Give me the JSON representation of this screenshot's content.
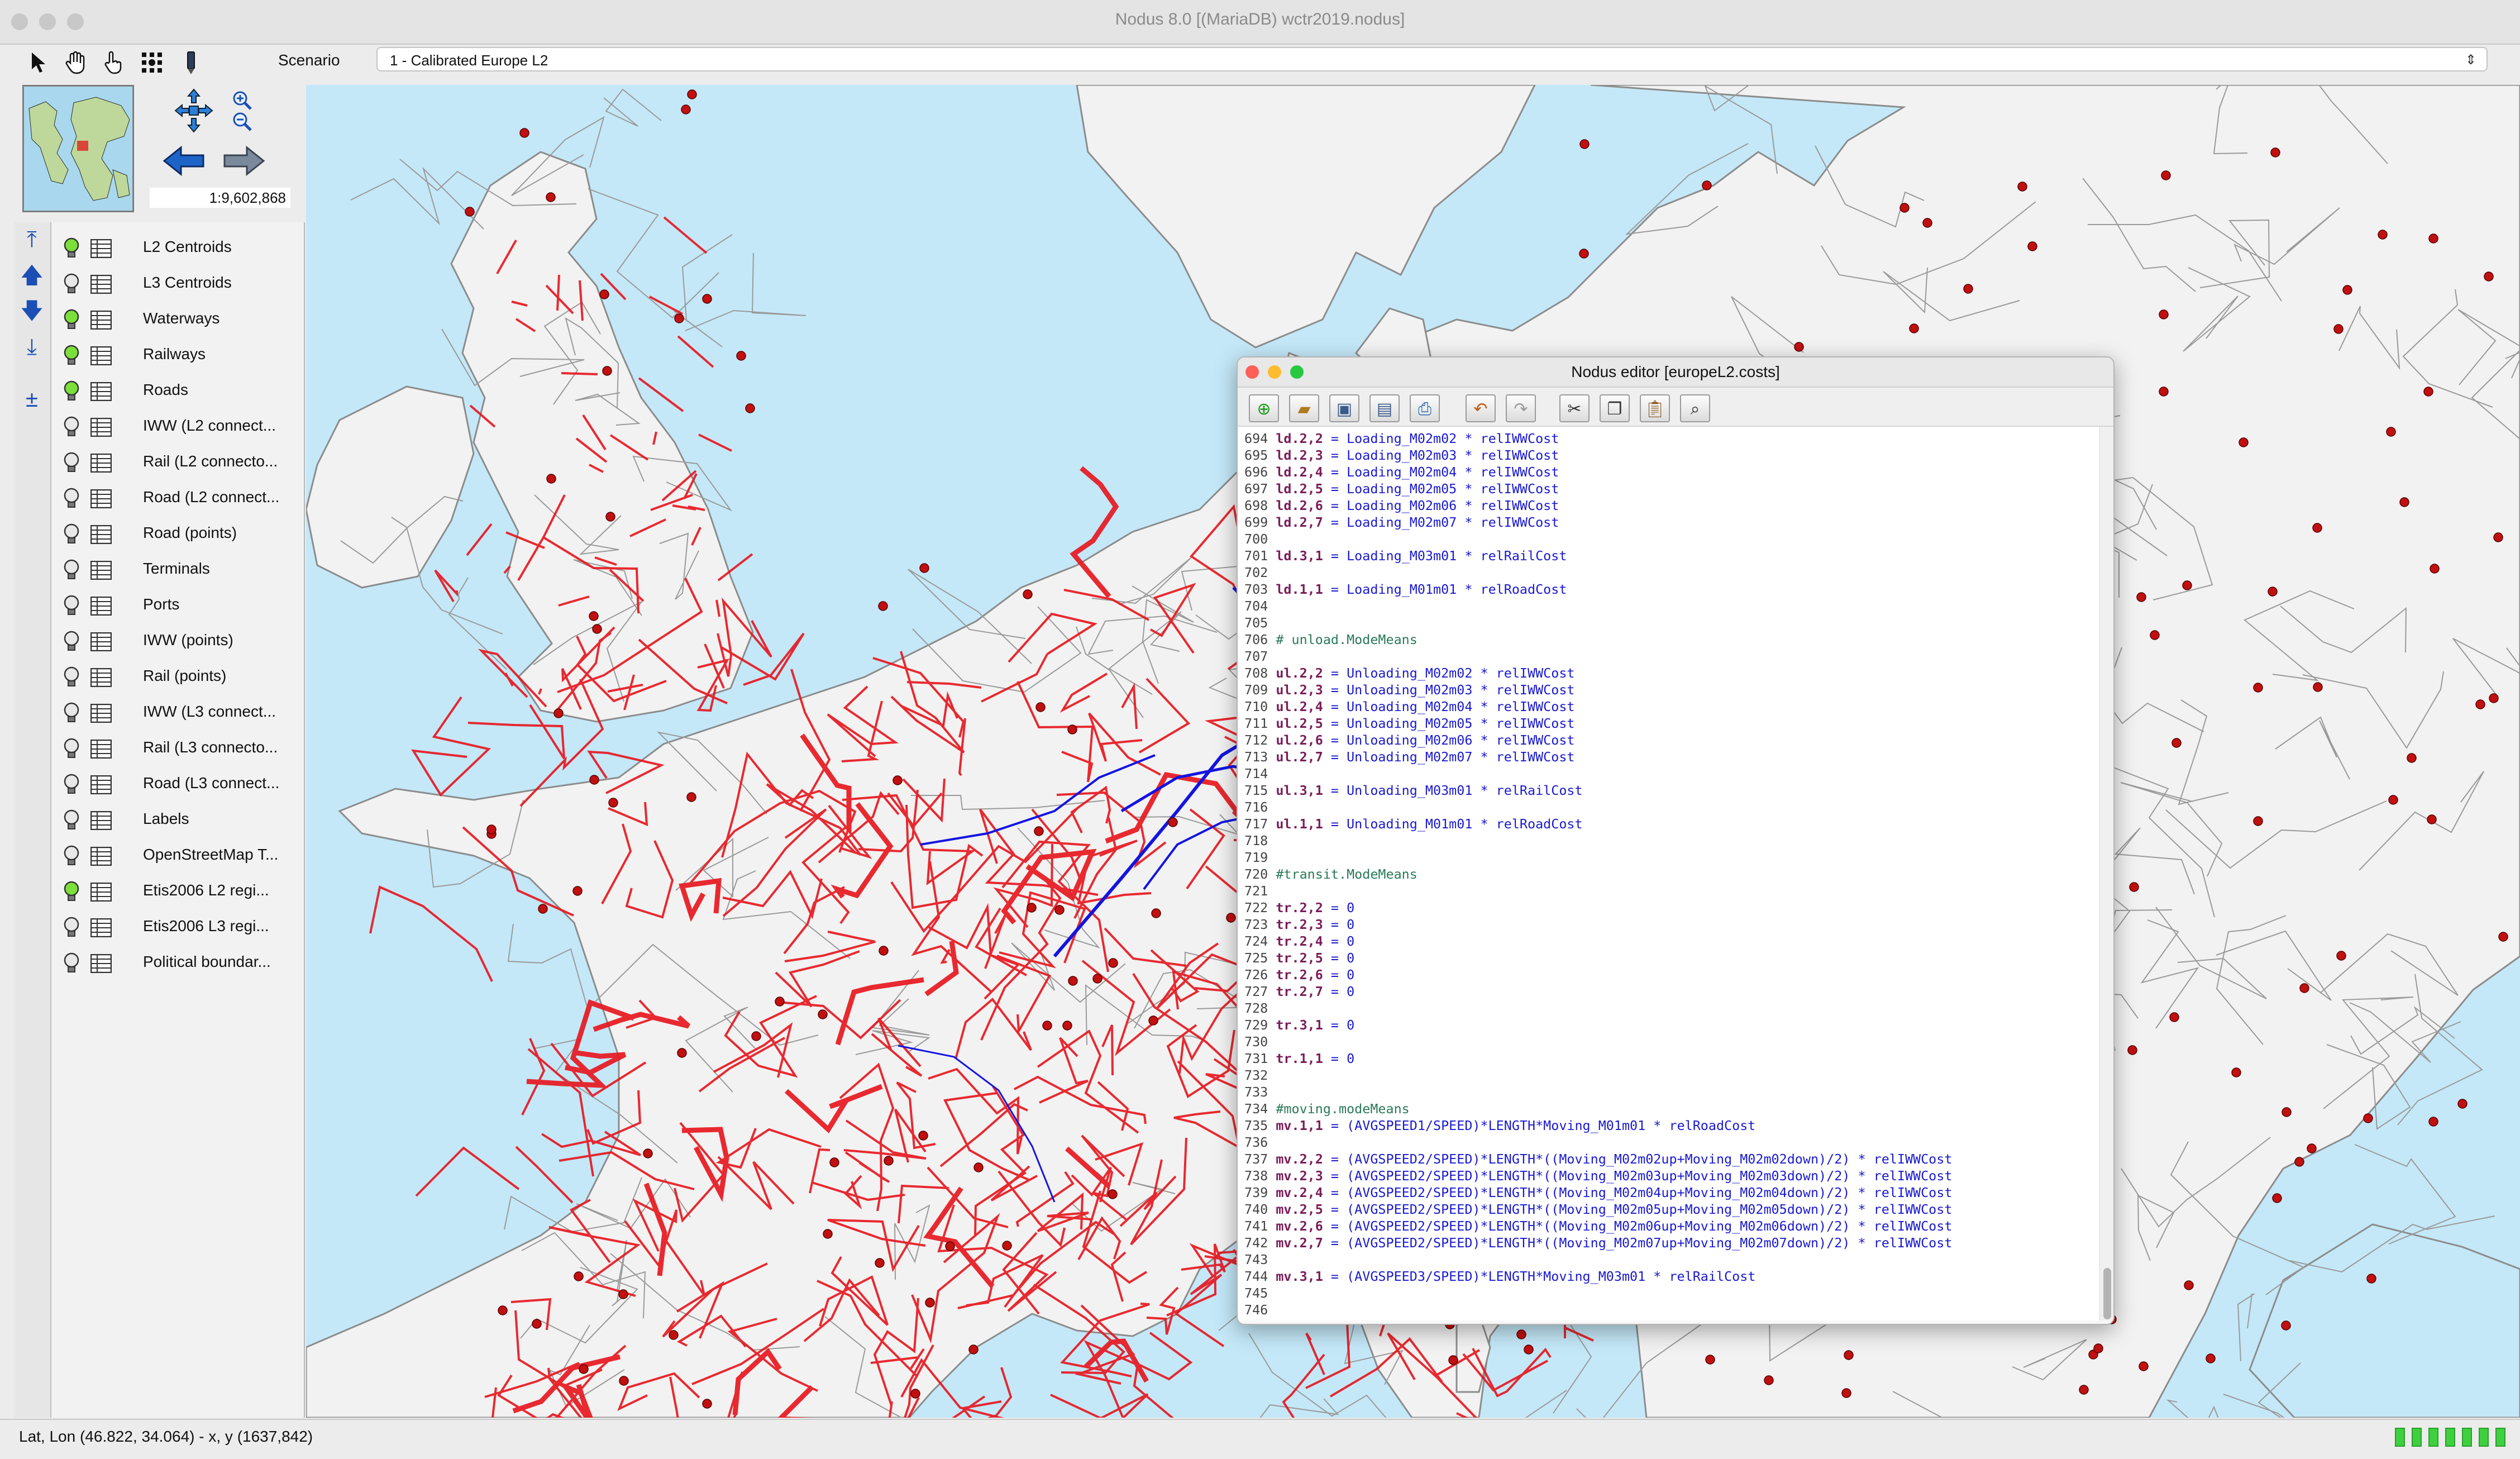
{
  "window": {
    "title": "Nodus 8.0 [(MariaDB) wctr2019.nodus]"
  },
  "toolbar": {
    "tools": [
      "arrow-pointer-icon",
      "hand-pan-icon",
      "finger-select-icon",
      "network-node-icon",
      "pen-edit-icon"
    ],
    "scenario_label": "Scenario",
    "scenario_value": "1 - Calibrated Europe L2"
  },
  "navigation": {
    "scale": "1:9,602,868"
  },
  "layers": [
    {
      "name": "L2 Centroids",
      "visible": true
    },
    {
      "name": "L3 Centroids",
      "visible": false
    },
    {
      "name": "Waterways",
      "visible": true
    },
    {
      "name": "Railways",
      "visible": true
    },
    {
      "name": "Roads",
      "visible": true
    },
    {
      "name": "IWW (L2 connect...",
      "visible": false
    },
    {
      "name": "Rail (L2 connecto...",
      "visible": false
    },
    {
      "name": "Road (L2 connect...",
      "visible": false
    },
    {
      "name": "Road (points)",
      "visible": false
    },
    {
      "name": "Terminals",
      "visible": false
    },
    {
      "name": "Ports",
      "visible": false
    },
    {
      "name": "IWW (points)",
      "visible": false
    },
    {
      "name": "Rail (points)",
      "visible": false
    },
    {
      "name": "IWW (L3 connect...",
      "visible": false
    },
    {
      "name": "Rail (L3 connecto...",
      "visible": false
    },
    {
      "name": "Road (L3 connect...",
      "visible": false
    },
    {
      "name": "Labels",
      "visible": false
    },
    {
      "name": "OpenStreetMap T...",
      "visible": false
    },
    {
      "name": "Etis2006 L2 regi...",
      "visible": true
    },
    {
      "name": "Etis2006 L3 regi...",
      "visible": false
    },
    {
      "name": "Political boundar...",
      "visible": false
    }
  ],
  "status": {
    "text": "Lat, Lon (46.822, 34.064) - x, y (1637,842)"
  },
  "editor": {
    "title": "Nodus editor [europeL2.costs]",
    "tools": [
      "new-file-icon",
      "open-folder-icon",
      "save-icon",
      "save-as-icon",
      "print-icon",
      "undo-icon",
      "redo-icon",
      "cut-icon",
      "copy-icon",
      "paste-icon",
      "find-icon"
    ],
    "lines": [
      {
        "n": "694",
        "v": "ld.2,2",
        "e": " = Loading_M02m02 * relIWWCost"
      },
      {
        "n": "695",
        "v": "ld.2,3",
        "e": " = Loading_M02m03 * relIWWCost"
      },
      {
        "n": "696",
        "v": "ld.2,4",
        "e": " = Loading_M02m04 * relIWWCost"
      },
      {
        "n": "697",
        "v": "ld.2,5",
        "e": " = Loading_M02m05 * relIWWCost"
      },
      {
        "n": "698",
        "v": "ld.2,6",
        "e": " = Loading_M02m06 * relIWWCost"
      },
      {
        "n": "699",
        "v": "ld.2,7",
        "e": " = Loading_M02m07 * relIWWCost"
      },
      {
        "n": "700",
        "v": "",
        "e": ""
      },
      {
        "n": "701",
        "v": "ld.3,1",
        "e": " = Loading_M03m01 * relRailCost"
      },
      {
        "n": "702",
        "v": "",
        "e": ""
      },
      {
        "n": "703",
        "v": "ld.1,1",
        "e": " = Loading_M01m01 * relRoadCost"
      },
      {
        "n": "704",
        "v": "",
        "e": ""
      },
      {
        "n": "705",
        "v": "",
        "e": ""
      },
      {
        "n": "706",
        "c": "# unload.ModeMeans"
      },
      {
        "n": "707",
        "v": "",
        "e": ""
      },
      {
        "n": "708",
        "v": "ul.2,2",
        "e": " = Unloading_M02m02 * relIWWCost"
      },
      {
        "n": "709",
        "v": "ul.2,3",
        "e": " = Unloading_M02m03 * relIWWCost"
      },
      {
        "n": "710",
        "v": "ul.2,4",
        "e": " = Unloading_M02m04 * relIWWCost"
      },
      {
        "n": "711",
        "v": "ul.2,5",
        "e": " = Unloading_M02m05 * relIWWCost"
      },
      {
        "n": "712",
        "v": "ul.2,6",
        "e": " = Unloading_M02m06 * relIWWCost"
      },
      {
        "n": "713",
        "v": "ul.2,7",
        "e": " = Unloading_M02m07 * relIWWCost"
      },
      {
        "n": "714",
        "v": "",
        "e": ""
      },
      {
        "n": "715",
        "v": "ul.3,1",
        "e": " = Unloading_M03m01 * relRailCost"
      },
      {
        "n": "716",
        "v": "",
        "e": ""
      },
      {
        "n": "717",
        "v": "ul.1,1",
        "e": " = Unloading_M01m01 * relRoadCost"
      },
      {
        "n": "718",
        "v": "",
        "e": ""
      },
      {
        "n": "719",
        "v": "",
        "e": ""
      },
      {
        "n": "720",
        "c": "#transit.ModeMeans"
      },
      {
        "n": "721",
        "v": "",
        "e": ""
      },
      {
        "n": "722",
        "v": "tr.2,2",
        "e": " = 0"
      },
      {
        "n": "723",
        "v": "tr.2,3",
        "e": " = 0"
      },
      {
        "n": "724",
        "v": "tr.2,4",
        "e": " = 0"
      },
      {
        "n": "725",
        "v": "tr.2,5",
        "e": " = 0"
      },
      {
        "n": "726",
        "v": "tr.2,6",
        "e": " = 0"
      },
      {
        "n": "727",
        "v": "tr.2,7",
        "e": " = 0"
      },
      {
        "n": "728",
        "v": "",
        "e": ""
      },
      {
        "n": "729",
        "v": "tr.3,1",
        "e": " = 0"
      },
      {
        "n": "730",
        "v": "",
        "e": ""
      },
      {
        "n": "731",
        "v": "tr.1,1",
        "e": " = 0"
      },
      {
        "n": "732",
        "v": "",
        "e": ""
      },
      {
        "n": "733",
        "v": "",
        "e": ""
      },
      {
        "n": "734",
        "c": "#moving.modeMeans"
      },
      {
        "n": "735",
        "v": "mv.1,1",
        "e": " = (AVGSPEED1/SPEED)*LENGTH*Moving_M01m01 * relRoadCost"
      },
      {
        "n": "736",
        "v": "",
        "e": ""
      },
      {
        "n": "737",
        "v": "mv.2,2",
        "e": " = (AVGSPEED2/SPEED)*LENGTH*((Moving_M02m02up+Moving_M02m02down)/2) * relIWWCost"
      },
      {
        "n": "738",
        "v": "mv.2,3",
        "e": " = (AVGSPEED2/SPEED)*LENGTH*((Moving_M02m03up+Moving_M02m03down)/2) * relIWWCost"
      },
      {
        "n": "739",
        "v": "mv.2,4",
        "e": " = (AVGSPEED2/SPEED)*LENGTH*((Moving_M02m04up+Moving_M02m04down)/2) * relIWWCost"
      },
      {
        "n": "740",
        "v": "mv.2,5",
        "e": " = (AVGSPEED2/SPEED)*LENGTH*((Moving_M02m05up+Moving_M02m05down)/2) * relIWWCost"
      },
      {
        "n": "741",
        "v": "mv.2,6",
        "e": " = (AVGSPEED2/SPEED)*LENGTH*((Moving_M02m06up+Moving_M02m06down)/2) * relIWWCost"
      },
      {
        "n": "742",
        "v": "mv.2,7",
        "e": " = (AVGSPEED2/SPEED)*LENGTH*((Moving_M02m07up+Moving_M02m07down)/2) * relIWWCost"
      },
      {
        "n": "743",
        "v": "",
        "e": ""
      },
      {
        "n": "744",
        "v": "mv.3,1",
        "e": " = (AVGSPEED3/SPEED)*LENGTH*Moving_M03m01 * relRailCost"
      },
      {
        "n": "745",
        "v": "",
        "e": ""
      },
      {
        "n": "746",
        "v": "",
        "e": ""
      }
    ]
  },
  "colors": {
    "sea": "#c4e8f8",
    "land": "#f2f2f2",
    "road": "#e8141c",
    "waterway": "#1414e0",
    "centroid": "#c01010",
    "border": "#8c8c8c"
  }
}
